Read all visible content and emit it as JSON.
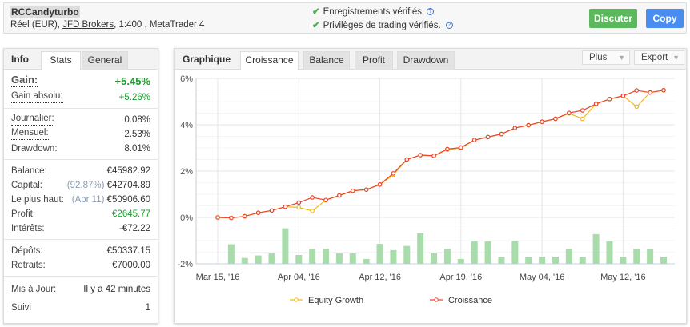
{
  "header": {
    "account_name": "RCCandyturbo",
    "account_type": "Réel (EUR), ",
    "broker": "JFD Brokers",
    "account_rest": ", 1:400 , MetaTrader 4",
    "verified": [
      "Enregistrements vérifiés",
      "Privilèges de trading vérifiés."
    ],
    "help_glyph": "?",
    "discuss_label": "Discuter",
    "copy_label": "Copy"
  },
  "left": {
    "title": "Info",
    "tabs": [
      "Stats",
      "General"
    ],
    "gain": {
      "label": "Gain:",
      "value": "+5.45%"
    },
    "rows1": [
      {
        "label": "Gain absolu:",
        "value": "+5.26%"
      }
    ],
    "rows2": [
      {
        "label": "Journalier:",
        "value": "0.08%"
      },
      {
        "label": "Mensuel:",
        "value": "2.53%"
      },
      {
        "label": "Drawdown:",
        "value": "8.01%"
      }
    ],
    "rows3": [
      {
        "label": "Balance:",
        "note": "",
        "value": "€45982.92"
      },
      {
        "label": "Capital:",
        "note": "(92.87%) ",
        "value": "€42704.89"
      },
      {
        "label": "Le plus haut:",
        "note": "(Apr 11) ",
        "value": "€50906.60"
      },
      {
        "label": "Profit:",
        "note": "",
        "value": "€2645.77"
      },
      {
        "label": "Intérêts:",
        "note": "",
        "value": "-€72.22"
      }
    ],
    "rows4": [
      {
        "label": "Dépôts:",
        "value": "€50337.15"
      },
      {
        "label": "Retraits:",
        "value": "€7000.00"
      }
    ],
    "rows5": [
      {
        "label": "Mis à Jour:",
        "value": "Il y a 42 minutes"
      },
      {
        "label": "Suivi",
        "value": "1"
      }
    ]
  },
  "right": {
    "title": "Graphique",
    "tabs": [
      "Croissance",
      "Balance",
      "Profit",
      "Drawdown"
    ],
    "more_label": "Plus",
    "export_label": "Export"
  },
  "chart_data": {
    "type": "line",
    "ylim": [
      -2,
      6
    ],
    "yticks": [
      "6%",
      "4%",
      "2%",
      "0%",
      "-2%"
    ],
    "ytick_values": [
      6,
      4,
      2,
      0,
      -2
    ],
    "xtick_labels": [
      {
        "label": "Mar 15, '16",
        "index": 0
      },
      {
        "label": "Apr 04, '16",
        "index": 6
      },
      {
        "label": "Apr 12, '16",
        "index": 12
      },
      {
        "label": "Apr 19, '16",
        "index": 18
      },
      {
        "label": "May 04, '16",
        "index": 24
      },
      {
        "label": "May 12, '16",
        "index": 30
      }
    ],
    "series": [
      {
        "name": "Equity Growth",
        "color": "#f5b914",
        "values": [
          0,
          -0.02,
          0.05,
          0.2,
          0.3,
          0.46,
          0.43,
          0.28,
          0.75,
          0.95,
          1.15,
          1.2,
          1.42,
          1.84,
          2.5,
          2.69,
          2.66,
          2.93,
          2.99,
          3.34,
          3.47,
          3.6,
          3.86,
          3.98,
          4.13,
          4.26,
          4.49,
          4.26,
          4.9,
          5.11,
          5.25,
          4.78,
          5.39,
          5.49
        ]
      },
      {
        "name": "Croissance",
        "color": "#e8432d",
        "values": [
          0,
          -0.02,
          0.05,
          0.2,
          0.3,
          0.46,
          0.64,
          0.86,
          0.75,
          0.95,
          1.15,
          1.2,
          1.42,
          1.9,
          2.5,
          2.69,
          2.66,
          2.95,
          3.02,
          3.34,
          3.47,
          3.6,
          3.86,
          3.98,
          4.13,
          4.26,
          4.51,
          4.62,
          4.9,
          5.11,
          5.25,
          5.48,
          5.39,
          5.49
        ]
      }
    ],
    "bars": {
      "color": "#a8dcaa",
      "values": [
        null,
        -1.16,
        -1.75,
        -1.64,
        -1.55,
        -0.47,
        -1.62,
        -1.35,
        -1.35,
        -1.55,
        -1.55,
        -1.79,
        -1.14,
        -1.41,
        -1.23,
        -0.69,
        -1.55,
        -1.35,
        -1.79,
        -1.03,
        -1.03,
        -1.69,
        -1.03,
        -1.69,
        -1.69,
        -1.69,
        -1.35,
        -1.69,
        -0.72,
        -1.03,
        -1.69,
        -1.35,
        -1.35,
        -1.69
      ]
    }
  }
}
